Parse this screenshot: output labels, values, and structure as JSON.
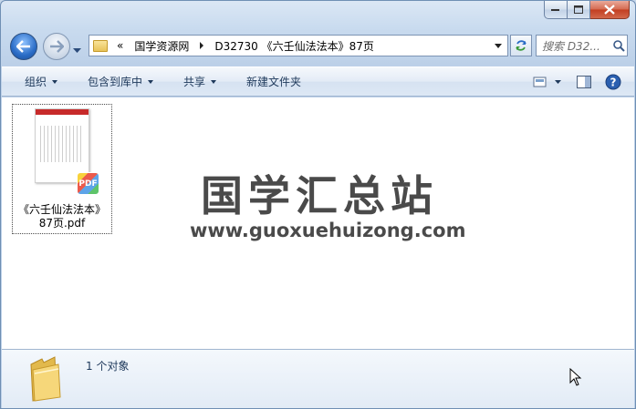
{
  "window": {
    "controls": {
      "minimize": "minimize",
      "maximize": "maximize",
      "close": "close"
    }
  },
  "address": {
    "overflow": "«",
    "crumbs": [
      "国学资源网",
      "D32730 《六壬仙法法本》87页"
    ]
  },
  "search": {
    "placeholder": "搜索 D32..."
  },
  "commands": {
    "organize": "组织",
    "include_library": "包含到库中",
    "share": "共享",
    "new_folder": "新建文件夹"
  },
  "files": [
    {
      "name": "《六壬仙法法本》87页.pdf",
      "badge": "PDF"
    }
  ],
  "watermark": {
    "cn": "国学汇总站",
    "url": "www.guoxuehuizong.com"
  },
  "details": {
    "count": "1 个对象"
  },
  "colors": {
    "accent": "#2a6cc6",
    "close": "#c23d20"
  }
}
